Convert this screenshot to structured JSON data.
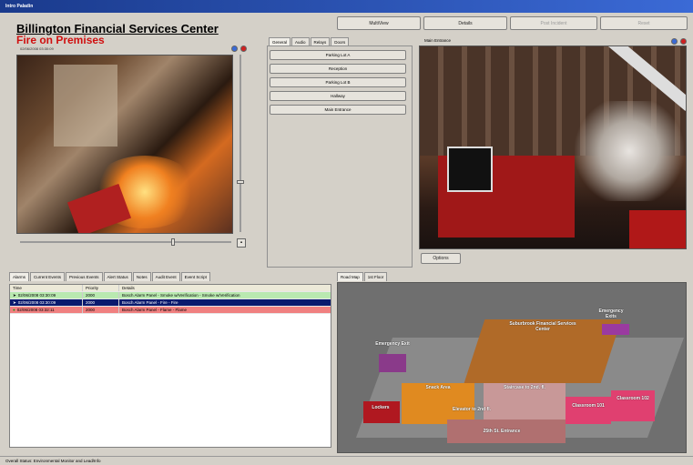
{
  "window": {
    "title": "Intro Paladin"
  },
  "toolbar": {
    "multiview": "MultiView",
    "details": "Details",
    "post_incident": "Post Incident",
    "reset": "Reset"
  },
  "header": {
    "title": "Billington Financial Services Center",
    "alert": "Fire on Premises",
    "timestamp": "02/06/2008 03:30:09"
  },
  "camera_tabs": [
    "General",
    "Audio",
    "Relays",
    "Doors"
  ],
  "cameras": [
    "Parking Lot A",
    "Reception",
    "Parking Lot B",
    "Hallway",
    "Main Entrance"
  ],
  "main_entrance": {
    "title": "Main Entrance",
    "options": "Options"
  },
  "event_tabs": [
    "Alarms",
    "Current Events",
    "Previous Events",
    "Alert Status",
    "Notes",
    "Audit Event",
    "Event Script"
  ],
  "table": {
    "headers": [
      "Time",
      "Priority",
      "Details"
    ],
    "rows": [
      {
        "time": "02/06/2008 03:30:09",
        "priority": "2000",
        "details": "Bosch Alarm Panel - Smoke w/Verification - Smoke w/Verification",
        "color": "#b9e9b0"
      },
      {
        "time": "02/06/2008 03:30:09",
        "priority": "2000",
        "details": "Bosch Alarm Panel - Fire - Fire",
        "color": "#0a1a6e"
      },
      {
        "time": "02/06/2008 03:32:11",
        "priority": "2000",
        "details": "Bosch Alarm Panel - Flame - Flame",
        "color": "#f08080"
      }
    ]
  },
  "map_tabs": [
    "Road Map",
    "1st Floor"
  ],
  "map_labels": {
    "hq": "Suburbrook Financial Services Center",
    "exit1": "Emergency Exit",
    "exit2": "Emergency Exits",
    "snack": "Snack Area",
    "stairs": "Staircase to 2nd. fl.",
    "elevator": "Elevator to 2nd fl.",
    "lockers": "Lockers",
    "classroom1": "Classroom 101",
    "classroom2": "Classroom 102",
    "entrance": "25th St. Entrance"
  },
  "statusbar": {
    "text": "Overall Status: Environmental Monitor and Lead/Info"
  }
}
